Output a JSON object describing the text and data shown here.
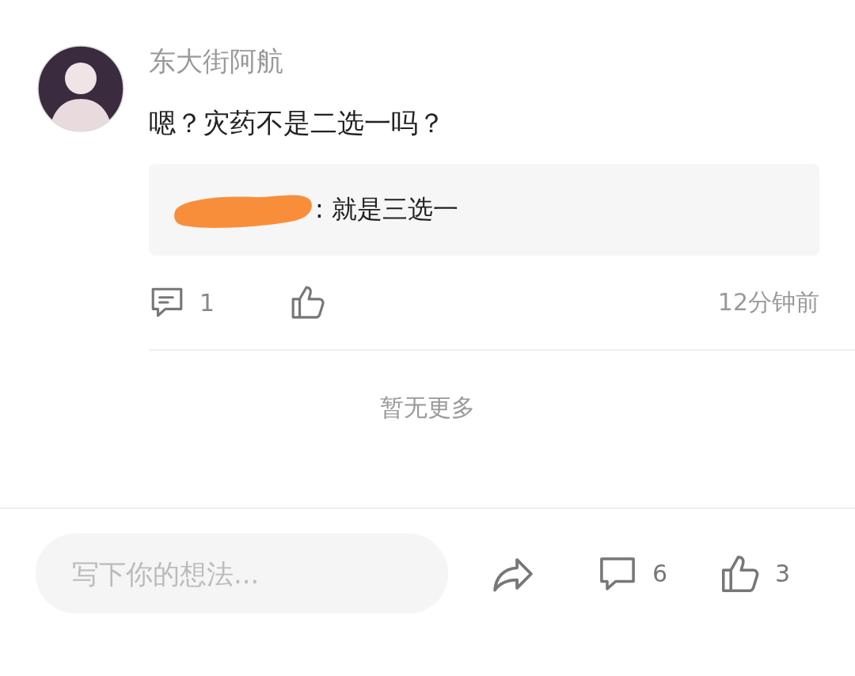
{
  "comment": {
    "author": "东大街阿航",
    "text": "嗯？灾药不是二选一吗？",
    "quote": {
      "redacted": true,
      "text": ": 就是三选一"
    },
    "reply_count": "1",
    "time": "12分钟前"
  },
  "end_note": "暂无更多",
  "bottom_bar": {
    "placeholder": "写下你的想法...",
    "comment_count": "6",
    "like_count": "3"
  }
}
